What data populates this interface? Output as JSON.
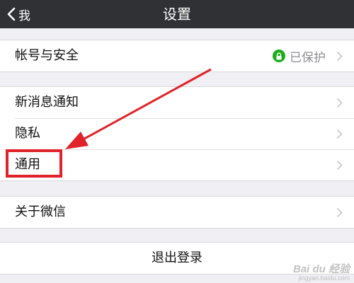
{
  "nav": {
    "back_label": "我",
    "title": "设置"
  },
  "account": {
    "label": "帐号与安全",
    "status": "已保护"
  },
  "group2": {
    "items": [
      {
        "label": "新消息通知"
      },
      {
        "label": "隐私"
      },
      {
        "label": "通用"
      }
    ]
  },
  "about": {
    "label": "关于微信"
  },
  "logout": {
    "label": "退出登录"
  },
  "annotation": {
    "highlight_color": "#e0222a"
  },
  "watermark": {
    "main": "Bai du 经验",
    "sub": "jingyan.baidu.com"
  },
  "colors": {
    "navbar": "#2f3134",
    "background": "#efeff4",
    "secure_badge": "#1aad19"
  }
}
